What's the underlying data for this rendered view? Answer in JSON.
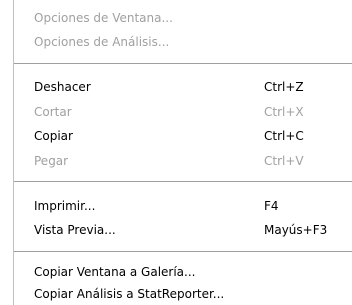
{
  "menu": {
    "items": [
      {
        "label": "Opciones de Ventana...",
        "shortcut": "",
        "enabled": false
      },
      {
        "label": "Opciones de Análisis...",
        "shortcut": "",
        "enabled": false
      },
      {
        "label": "Deshacer",
        "shortcut": "Ctrl+Z",
        "enabled": true
      },
      {
        "label": "Cortar",
        "shortcut": "Ctrl+X",
        "enabled": false
      },
      {
        "label": "Copiar",
        "shortcut": "Ctrl+C",
        "enabled": true
      },
      {
        "label": "Pegar",
        "shortcut": "Ctrl+V",
        "enabled": false
      },
      {
        "label": "Imprimir...",
        "shortcut": "F4",
        "enabled": true
      },
      {
        "label": "Vista Previa...",
        "shortcut": "Mayús+F3",
        "enabled": true
      },
      {
        "label": "Copiar Ventana a Galería...",
        "shortcut": "",
        "enabled": true
      },
      {
        "label": "Copiar Análisis a StatReporter...",
        "shortcut": "",
        "enabled": true
      }
    ]
  }
}
